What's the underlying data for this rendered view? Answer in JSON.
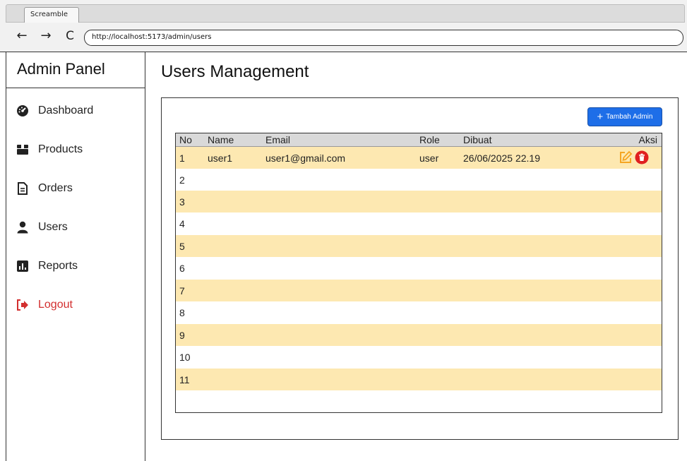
{
  "browser": {
    "tab_title": "Screamble",
    "url": "http://localhost:5173/admin/users",
    "back_icon": "←",
    "forward_icon": "→",
    "reload_icon": "C"
  },
  "sidebar": {
    "title": "Admin Panel",
    "items": [
      {
        "label": "Dashboard",
        "icon": "gauge-icon"
      },
      {
        "label": "Products",
        "icon": "box-icon"
      },
      {
        "label": "Orders",
        "icon": "document-icon"
      },
      {
        "label": "Users",
        "icon": "user-icon"
      },
      {
        "label": "Reports",
        "icon": "chart-icon"
      },
      {
        "label": "Logout",
        "icon": "logout-icon",
        "color": "#d32f2f"
      }
    ]
  },
  "main": {
    "title": "Users Management",
    "add_button_label": "Tambah Admin",
    "table": {
      "headers": {
        "no": "No",
        "name": "Name",
        "email": "Email",
        "role": "Role",
        "dibuat": "Dibuat",
        "aksi": "Aksi"
      },
      "rows": [
        {
          "no": "1",
          "name": "user1",
          "email": "user1@gmail.com",
          "role": "user",
          "dibuat": "26/06/2025 22.19"
        },
        {
          "no": "2"
        },
        {
          "no": "3"
        },
        {
          "no": "4"
        },
        {
          "no": "5"
        },
        {
          "no": "6"
        },
        {
          "no": "7"
        },
        {
          "no": "8"
        },
        {
          "no": "9"
        },
        {
          "no": "10"
        },
        {
          "no": "11"
        }
      ]
    }
  },
  "colors": {
    "accent": "#1e6ee8",
    "row_highlight": "#fde8b1",
    "edit": "#f5a623",
    "delete": "#e02020",
    "logout": "#d32f2f"
  }
}
